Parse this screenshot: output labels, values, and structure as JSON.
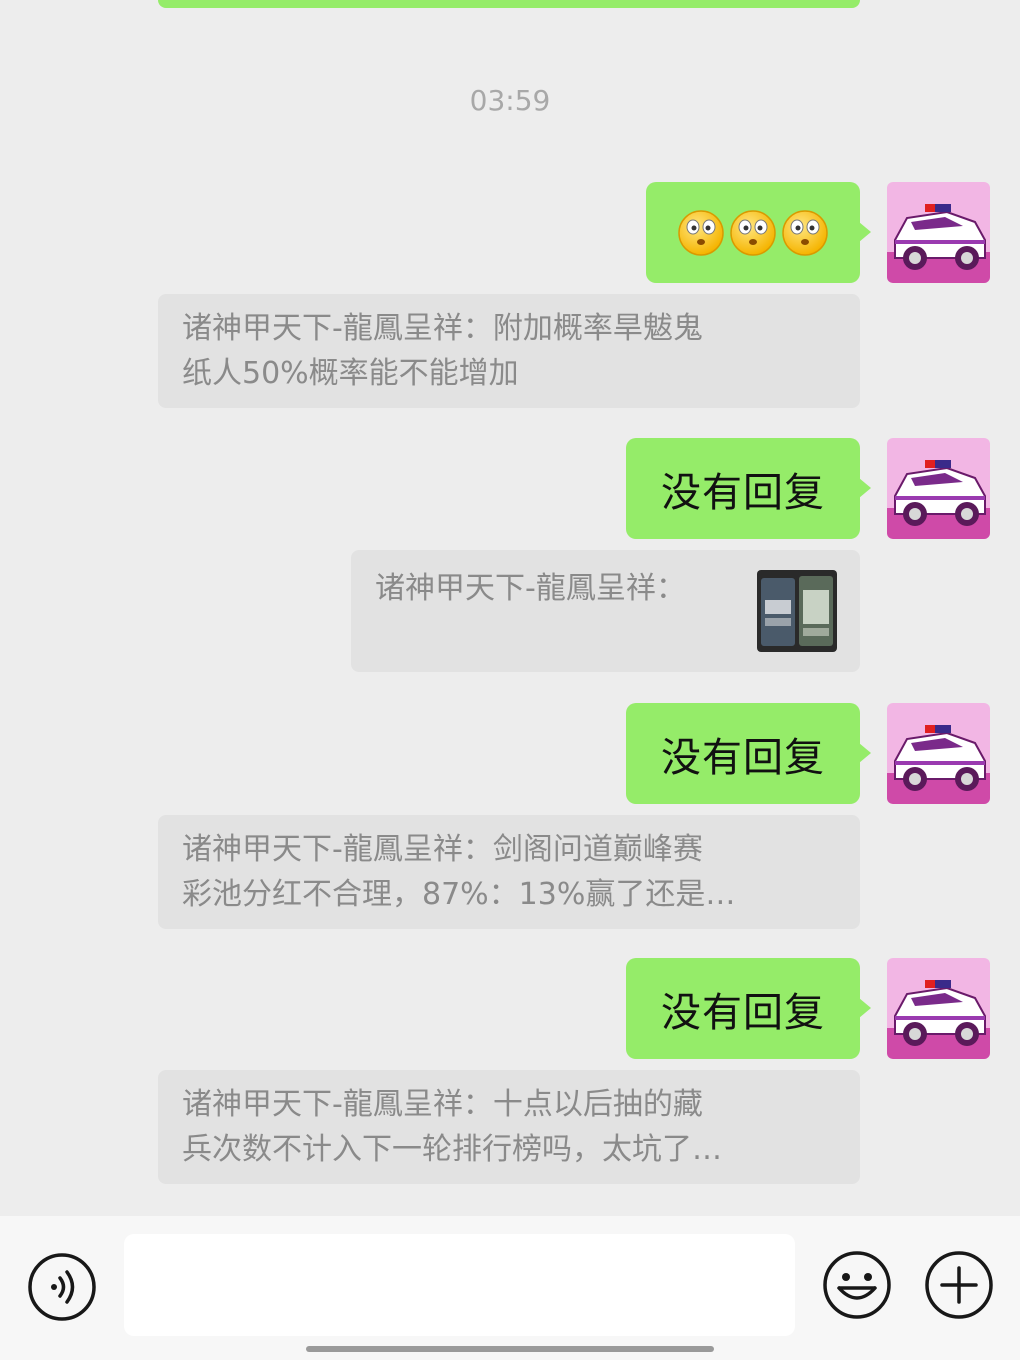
{
  "chat": {
    "timestamp": "03:59",
    "messages": [
      {
        "type": "outgoing-emoji",
        "emoji_icons": [
          "confused-face-emoji",
          "confused-face-emoji",
          "confused-face-emoji"
        ]
      },
      {
        "type": "quote",
        "line1": "诸神甲天下-龍鳳呈祥：附加概率旱魃鬼",
        "line2": "纸人50%概率能不能增加"
      },
      {
        "type": "outgoing",
        "text": "没有回复"
      },
      {
        "type": "quote-image",
        "label": "诸神甲天下-龍鳳呈祥："
      },
      {
        "type": "outgoing",
        "text": "没有回复"
      },
      {
        "type": "quote",
        "line1": "诸神甲天下-龍鳳呈祥：剑阁问道巅峰赛",
        "line2": "彩池分红不合理，87%：13%赢了还是…"
      },
      {
        "type": "outgoing",
        "text": "没有回复"
      },
      {
        "type": "quote",
        "line1": "诸神甲天下-龍鳳呈祥：十点以后抽的藏",
        "line2": "兵次数不计入下一轮排行榜吗，太坑了…"
      }
    ]
  },
  "input_bar": {
    "input_value": "",
    "voice_icon": "voice-icon",
    "emoji_icon": "emoji-icon",
    "plus_icon": "plus-icon"
  },
  "colors": {
    "outgoing_bubble": "#95ec69",
    "quote_bg": "#e2e2e2",
    "chat_bg": "#ededed"
  }
}
